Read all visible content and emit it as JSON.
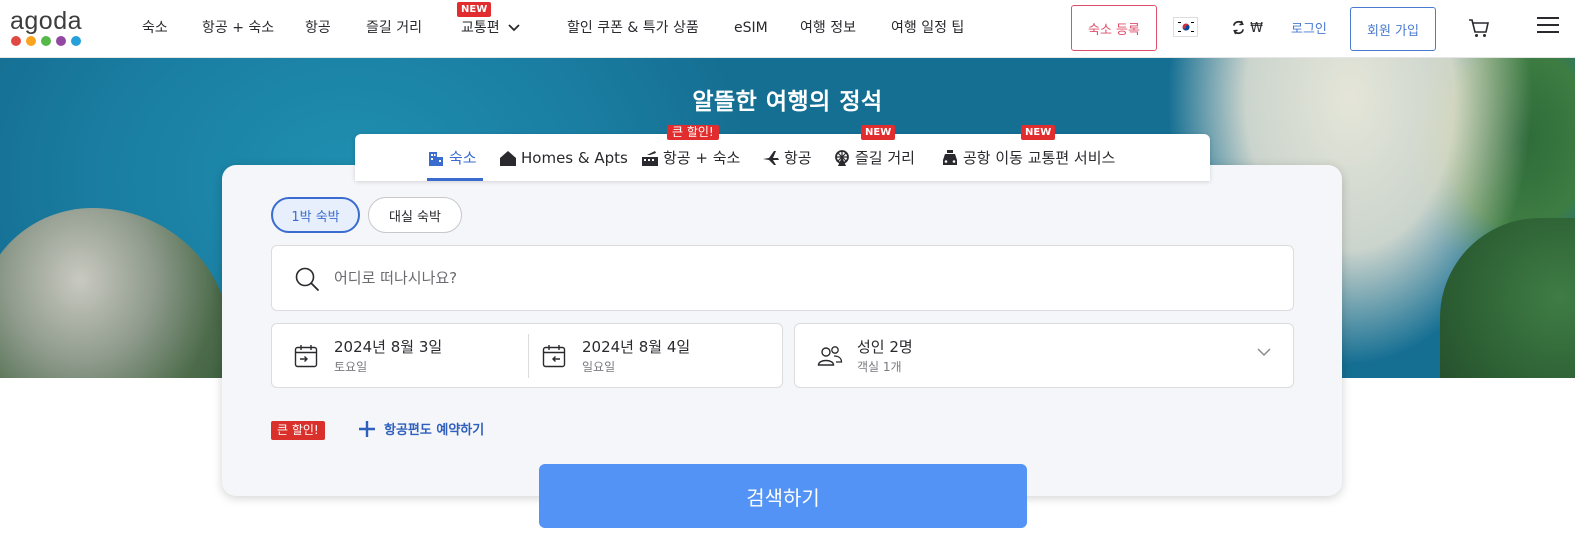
{
  "header": {
    "logo_text": "agoda",
    "logo_dot_colors": [
      "#e24843",
      "#f8a41e",
      "#55b848",
      "#9248a3",
      "#26a0d9"
    ],
    "nav": [
      {
        "label": "숙소"
      },
      {
        "label": "항공 + 숙소"
      },
      {
        "label": "항공"
      },
      {
        "label": "즐길 거리"
      },
      {
        "label": "교통편",
        "badge": "NEW"
      },
      {
        "label": "할인 쿠폰 & 특가 상품"
      },
      {
        "label": "eSIM"
      },
      {
        "label": "여행 정보"
      },
      {
        "label": "여행 일정 팁"
      }
    ],
    "register_label": "숙소 등록",
    "currency_label": "₩",
    "login_label": "로그인",
    "signup_label": "회원 가입"
  },
  "hero": {
    "title": "알뜰한 여행의 정석"
  },
  "tabs": [
    {
      "label": "숙소",
      "icon": "building-icon",
      "active": true
    },
    {
      "label": "Homes & Apts",
      "icon": "house-icon"
    },
    {
      "label": "항공 + 숙소",
      "icon": "flight-hotel-icon",
      "badge": "큰 할인!"
    },
    {
      "label": "항공",
      "icon": "plane-icon"
    },
    {
      "label": "즐길 거리",
      "icon": "ferris-wheel-icon",
      "badge": "NEW"
    },
    {
      "label": "공항 이동 교통편 서비스",
      "icon": "car-icon",
      "badge": "NEW"
    }
  ],
  "search": {
    "stay_types": [
      "1박 숙박",
      "대실 숙박"
    ],
    "destination_placeholder": "어디로 떠나시나요?",
    "checkin": {
      "date": "2024년 8월 3일",
      "day": "토요일"
    },
    "checkout": {
      "date": "2024년 8월 4일",
      "day": "일요일"
    },
    "guests": {
      "adults": "성인 2명",
      "rooms": "객실 1개"
    },
    "promo_badge": "큰 할인!",
    "add_flight_label": "항공편도 예약하기",
    "search_button_label": "검색하기"
  },
  "colors": {
    "accent": "#3a6ccf",
    "search_button": "#5393f5",
    "badge_red": "#e12d2d",
    "register_pink": "#e04f6b"
  }
}
